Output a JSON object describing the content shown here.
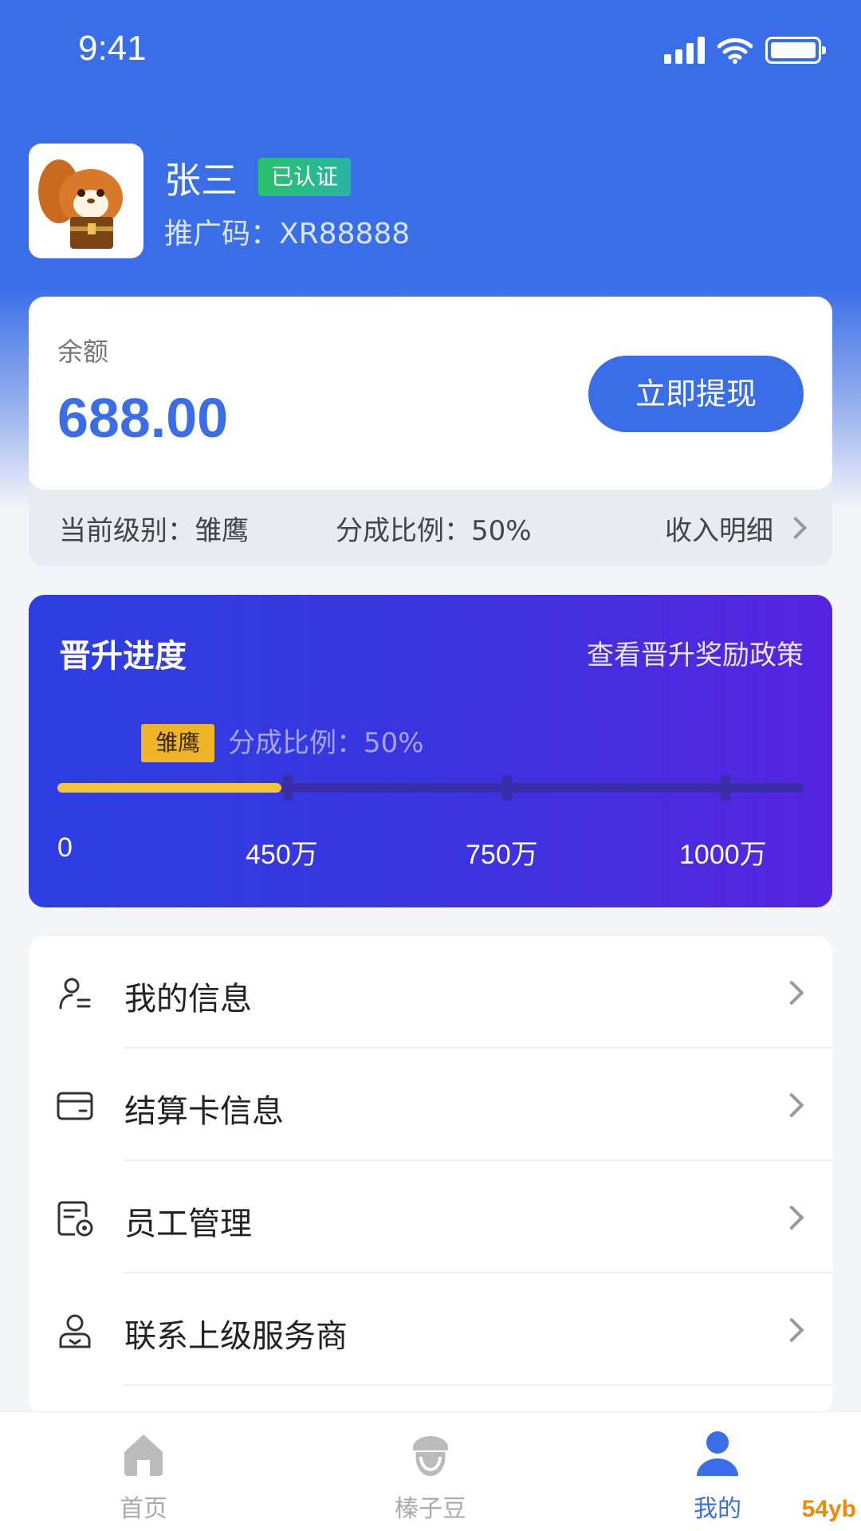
{
  "status_bar": {
    "time": "9:41"
  },
  "profile": {
    "name": "张三",
    "verified_badge": "已认证",
    "promo_code": "推广码：XR88888"
  },
  "balance": {
    "label": "余额",
    "value": "688.00",
    "withdraw_label": "立即提现",
    "current_level": "当前级别：雏鹰",
    "share_ratio": "分成比例：50%",
    "income_detail": "收入明细"
  },
  "promotion": {
    "title": "晋升进度",
    "policy_link": "查看晋升奖励政策",
    "level_tag": "雏鹰",
    "level_ratio": "分成比例：50%",
    "progress": 0.3,
    "milestones": [
      "0",
      "450万",
      "750万",
      "1000万"
    ]
  },
  "menu": {
    "items": [
      {
        "label": "我的信息",
        "icon": "user-info-icon"
      },
      {
        "label": "结算卡信息",
        "icon": "bank-card-icon"
      },
      {
        "label": "员工管理",
        "icon": "staff-manage-icon"
      },
      {
        "label": "联系上级服务商",
        "icon": "contact-provider-icon"
      }
    ]
  },
  "tab_bar": {
    "items": [
      {
        "label": "首页",
        "icon": "home-icon"
      },
      {
        "label": "榛子豆",
        "icon": "hazelnut-icon"
      },
      {
        "label": "我的",
        "icon": "profile-icon"
      }
    ],
    "active": "我的"
  },
  "watermark": "54yb",
  "colors": {
    "primary": "#3a6ee8",
    "gold": "#f5c43a",
    "verified": "#27c16b"
  }
}
